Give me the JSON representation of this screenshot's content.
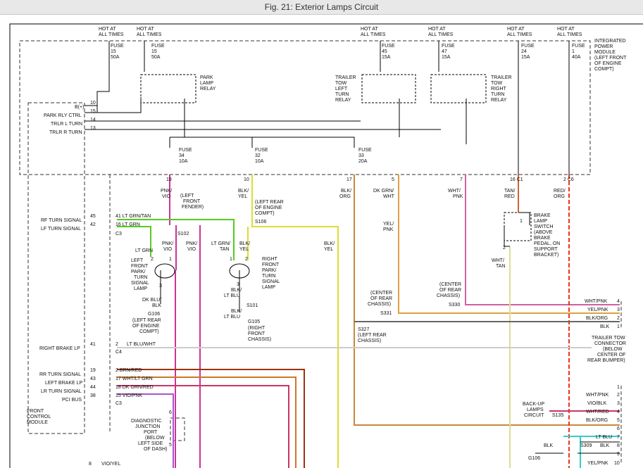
{
  "window": {
    "title": "Fig. 21: Exterior Lamps Circuit"
  },
  "labels": {
    "hot1": [
      "HOT AT",
      "ALL TIMES"
    ],
    "hot2": [
      "HOT AT",
      "ALL TIMES"
    ],
    "hot3": [
      "HOT AT",
      "ALL TIMES"
    ],
    "hot4": [
      "HOT AT",
      "ALL TIMES"
    ],
    "hot5": [
      "HOT AT",
      "ALL TIMES"
    ],
    "hot6": [
      "HOT AT",
      "ALL TIMES"
    ],
    "fuse15a": [
      "FUSE",
      "15",
      "50A"
    ],
    "fuse15b": [
      "FUSE",
      "15",
      "50A"
    ],
    "fuse45": [
      "FUSE",
      "45",
      "15A"
    ],
    "fuse47": [
      "FUSE",
      "47",
      "15A"
    ],
    "fuse24": [
      "FUSE",
      "24",
      "15A"
    ],
    "fuse1": [
      "FUSE",
      "1",
      "40A"
    ],
    "ipm": [
      "INTEGRATED",
      "POWER",
      "MODULE",
      "(LEFT FRONT",
      "OF ENGINE",
      "COMPT)"
    ],
    "park_relay": [
      "PARK",
      "LAMP",
      "RELAY"
    ],
    "ttl_relay": [
      "TRAILER",
      "TOW",
      "LEFT",
      "TURN",
      "RELAY"
    ],
    "ttr_relay": [
      "TRAILER",
      "TOW",
      "RIGHT",
      "TURN",
      "RELAY"
    ],
    "fuse34": [
      "FUSE",
      "34",
      "10A"
    ],
    "fuse32": [
      "FUSE",
      "32",
      "10A"
    ],
    "fuse33": [
      "FUSE",
      "33",
      "20A"
    ],
    "b_plus": "B(+)",
    "park_rly_ctrl": "PARK RLY CTRL",
    "trlr_l_turn": "TRLR L TURN",
    "trlr_r_turn": "TRLR R TURN",
    "pin10": "10",
    "pin15": "15",
    "pin14": "14",
    "pin13": "13",
    "pin19": "19",
    "pin10b": "10",
    "pin17": "17",
    "pin5": "5",
    "pin7": "7",
    "pin16c1": "16  C1",
    "pin2c6": "2  C6",
    "w_pnk_vio": [
      "PNK/",
      "VIO"
    ],
    "w_blk_yel": [
      "BLK/",
      "YEL"
    ],
    "w_blk_org": [
      "BLK/",
      "ORG"
    ],
    "w_dkgrn_wht": [
      "DK GRN/",
      "WHT"
    ],
    "w_wht_pnk": [
      "WHT/",
      "PNK"
    ],
    "w_tan_red": [
      "TAN/",
      "RED"
    ],
    "w_red_org": [
      "RED/",
      "ORG"
    ],
    "lf_fender": [
      "(LEFT",
      "FRONT",
      "FENDER)"
    ],
    "lr_engine": [
      "(LEFT REAR",
      "OF ENGINE",
      "COMPT)"
    ],
    "s106": "S106",
    "rf_turn_signal": "RF TURN SIGNAL",
    "lf_turn_signal": "LF TURN SIGNAL",
    "pin45": "45",
    "pin42": "42",
    "c3a": "C3",
    "ltgrn_tan": "41  LT GRN/TAN",
    "ltgrn16": "16  LT GRN",
    "s102": "S102",
    "w_ltgrn": "LT GRN",
    "w_pnk_vio2": [
      "PNK/",
      "VIO"
    ],
    "w_pnk_vio3": [
      "PNK/",
      "VIO"
    ],
    "w_ltgrn_tan": [
      "LT GRN/",
      "TAN"
    ],
    "w_blk_yel2": [
      "BLK/",
      "YEL"
    ],
    "w_blk_yel3": [
      "BLK/",
      "YEL"
    ],
    "w_yel_pnk": [
      "YEL/",
      "PNK"
    ],
    "lfp_lamp": [
      "LEFT",
      "FRONT",
      "PARK/",
      "TURN",
      "SIGNAL",
      "LAMP"
    ],
    "rfp_lamp": [
      "RIGHT",
      "FRONT",
      "PARK/",
      "TURN",
      "SIGNAL",
      "LAMP"
    ],
    "p2a": "2",
    "p1a": "1",
    "p3a": "3",
    "p2b": "2",
    "p1b": "1",
    "p3b": "3",
    "w_dkblu_blk": [
      "DK BLU/",
      "BLK"
    ],
    "w_blk_ltblu": [
      "BLK/",
      "LT BLU"
    ],
    "s101": "S101",
    "w_blk_ltblu2": [
      "BLK/",
      "LT BLU"
    ],
    "g106": "G106",
    "g106_loc": [
      "(LEFT REAR",
      "OF ENGINE",
      "COMPT)"
    ],
    "g105": "G105",
    "g105_loc": [
      "(RIGHT",
      "FRONT",
      "CHASSIS)"
    ],
    "brake_switch": [
      "BRAKE",
      "LAMP",
      "SWITCH",
      "(ABOVE",
      "BRAKE",
      "PEDAL, ON",
      "SUPPORT",
      "BRACKET)"
    ],
    "pin1s": "1",
    "pin2s": "2",
    "w_wht_tan": [
      "WHT/",
      "TAN"
    ],
    "center_rear1": [
      "(CENTER",
      "OF REAR",
      "CHASSIS)"
    ],
    "s331": "S331",
    "center_rear2": [
      "(CENTER",
      "OF REAR",
      "CHASSIS)"
    ],
    "s330": "S330",
    "s327": "S327",
    "lr_chassis": [
      "(LEFT REAR",
      "CHASSIS)"
    ],
    "right_brake_lp": "RIGHT BRAKE LP",
    "pin41": "41",
    "pin2c4": "2",
    "c4": "C4",
    "w_ltblu_wht": "LT BLU/WHT",
    "rr_turn": "RR TURN SIGNAL",
    "left_brake": "LEFT BRAKE LP",
    "lr_turn": "LR TURN SIGNAL",
    "pci_bus": "PCI BUS",
    "pin19b": "19",
    "pin43": "43",
    "pin44": "44",
    "pin38": "38",
    "w_brn_red": "2   BRN/RED",
    "w_wht_ltgrn": "17  WHT/LT GRN",
    "w_dkgrn_red": "18  DK GRN/RED",
    "w_vio_pnk": "15  VIO/PNK",
    "c3b": "C3",
    "fcm": [
      "FRONT",
      "CONTROL",
      "MODULE"
    ],
    "djp": [
      "DIAGNOSTIC",
      "JUNCTION",
      "PORT",
      "(BELOW",
      "LEFT SIDE",
      "OF DASH)"
    ],
    "pin6": "6",
    "pin5b": "5",
    "pin8": "8",
    "w_vio_yel": "VIO/YEL",
    "tr_wht_pnk": "WHT/PNK",
    "tr_yel_pnk": "YEL/PNK",
    "tr_blk_org": "BLK/ORG",
    "tr_blk": "BLK",
    "tr_n4": "4",
    "tr_n3": "3",
    "tr_n2": "2",
    "tr_n1": "1",
    "trailer_conn": [
      "TRAILER TOW",
      "CONNECTOR",
      "(BELOW",
      "CENTER OF",
      "REAR BUMPER)"
    ],
    "b2_wht_pnk": "WHT/PNK",
    "b2_vio_blk": "VIO/BLK",
    "b2_wht_red": "WHT/RED",
    "b2_blk_org": "BLK/ORG",
    "b2_lt_blu": "LT BLU",
    "b2_blk": "BLK",
    "b2_blk2": "BLK",
    "b2_yel_pnk": "YEL/PNK",
    "s309": "S309",
    "b2_n1": "1",
    "b2_n2": "2",
    "b2_n3": "3",
    "b2_n4": "4",
    "b2_n5": "5",
    "b2_n6": "6",
    "b2_n7": "7",
    "b2_n8": "8",
    "b2_n9": "9",
    "b2_n10": "10",
    "backup": [
      "BACK-UP",
      "LAMPS",
      "CIRCUIT"
    ],
    "s135": "S135",
    "g106b": "G106"
  },
  "colors": {
    "pnk_vio": "#cc3399",
    "blk_yel": "#dddd33",
    "blk_org": "#c8873a",
    "lt_grn": "#55cc22",
    "wht_pnk": "#d060a0",
    "tan_red": "#cc6633",
    "red_org": "#ee3322",
    "brn_red": "#993311",
    "lt_blu": "#33cccc",
    "lt_blu_wht": "#cccccc",
    "yel_pnk": "#e0a040",
    "dk_grn_red": "#cc3366",
    "dk_blu": "#444444"
  }
}
